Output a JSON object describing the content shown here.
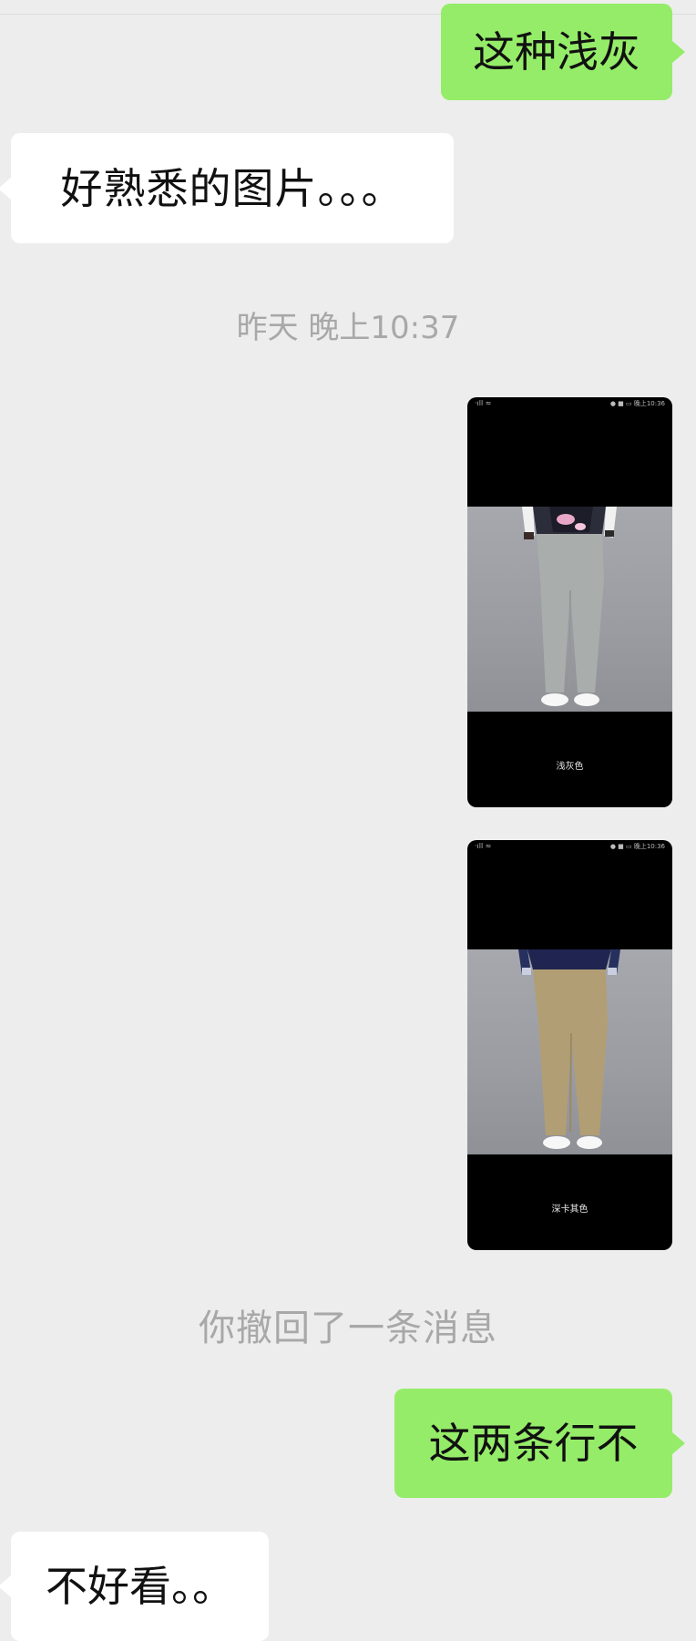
{
  "messages": {
    "m1": "这种浅灰",
    "m2": "好熟悉的图片。。。",
    "timestamp": "昨天 晚上10:37",
    "recall_notice": "你撤回了一条消息",
    "m3": "这两条行不",
    "m4": "不好看。。"
  },
  "shots": [
    {
      "status_left": "·ıll ≈",
      "status_right": "● ■ ▭ 晚上10:36",
      "caption": "浅灰色",
      "pants_color": "#a9aeac"
    },
    {
      "status_left": "·ıll ≈",
      "status_right": "● ■ ▭ 晚上10:36",
      "caption": "深卡其色",
      "pants_color": "#b29e74"
    }
  ],
  "colors": {
    "background": "#ededed",
    "sent_bubble": "#95ec69",
    "recv_bubble": "#ffffff",
    "system_text": "#a8a8a8"
  }
}
